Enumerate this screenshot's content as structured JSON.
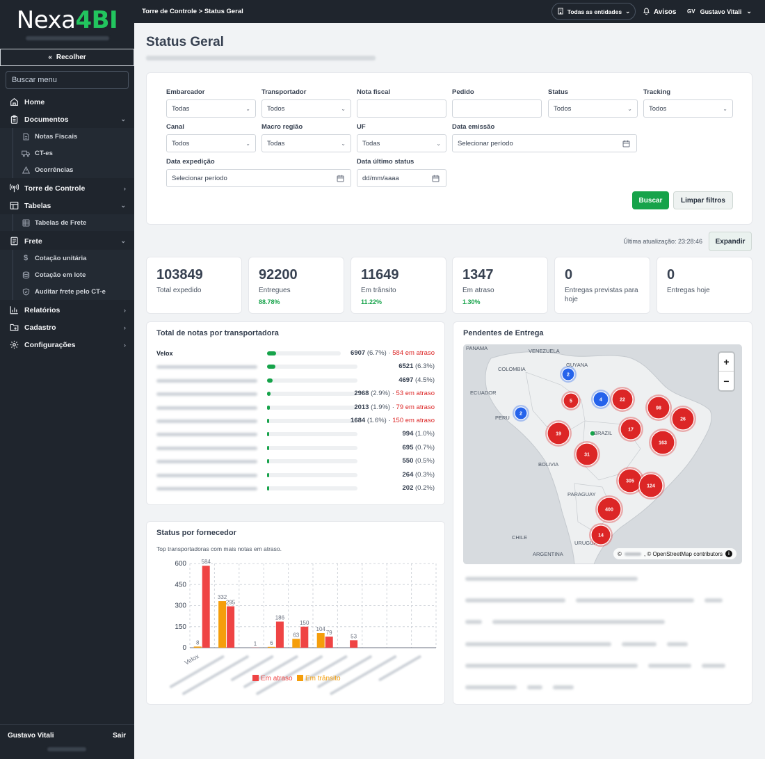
{
  "app": {
    "logo_main": "Nexa",
    "logo_accent": "4BI"
  },
  "sidebar": {
    "collapse_label": "Recolher",
    "search_placeholder": "Buscar menu",
    "items": [
      {
        "label": "Home",
        "icon": "home-icon"
      },
      {
        "label": "Documentos",
        "icon": "clipboard-icon",
        "expanded": true,
        "children": [
          {
            "label": "Notas Fiscais",
            "icon": "file-icon"
          },
          {
            "label": "CT-es",
            "icon": "truck-icon"
          },
          {
            "label": "Ocorrências",
            "icon": "warning-icon"
          }
        ]
      },
      {
        "label": "Torre de Controle",
        "icon": "antenna-icon",
        "expanded": false
      },
      {
        "label": "Tabelas",
        "icon": "table-icon",
        "expanded": true,
        "children": [
          {
            "label": "Tabelas de Frete",
            "icon": "grid-icon"
          }
        ]
      },
      {
        "label": "Frete",
        "icon": "receipt-icon",
        "expanded": true,
        "children": [
          {
            "label": "Cotação unitária",
            "icon": "dollar-icon"
          },
          {
            "label": "Cotação em lote",
            "icon": "layers-icon"
          },
          {
            "label": "Auditar frete pelo CT-e",
            "icon": "shield-check-icon"
          }
        ]
      },
      {
        "label": "Relatórios",
        "icon": "bar-chart-icon",
        "expanded": false
      },
      {
        "label": "Cadastro",
        "icon": "folder-icon",
        "expanded": false
      },
      {
        "label": "Configurações",
        "icon": "gear-icon",
        "expanded": false
      }
    ],
    "footer": {
      "user_name": "Gustavo Vitali",
      "logout_label": "Sair"
    }
  },
  "topbar": {
    "breadcrumb": "Torre de Controle > Status Geral",
    "entities_label": "Todas as entidades",
    "notifications_label": "Avisos",
    "user_initials": "GV",
    "user_name": "Gustavo Vitali"
  },
  "page": {
    "title": "Status Geral"
  },
  "filters": {
    "embarcador": {
      "label": "Embarcador",
      "value": "Todas"
    },
    "transportador": {
      "label": "Transportador",
      "value": "Todos"
    },
    "nota_fiscal": {
      "label": "Nota fiscal",
      "value": ""
    },
    "pedido": {
      "label": "Pedido",
      "value": ""
    },
    "status": {
      "label": "Status",
      "value": "Todos"
    },
    "tracking": {
      "label": "Tracking",
      "value": "Todos"
    },
    "canal": {
      "label": "Canal",
      "value": "Todos"
    },
    "macro_regiao": {
      "label": "Macro região",
      "value": "Todas"
    },
    "uf": {
      "label": "UF",
      "value": "Todas"
    },
    "data_emissao": {
      "label": "Data emissão",
      "placeholder": "Selecionar período"
    },
    "data_expedicao": {
      "label": "Data expedição",
      "placeholder": "Selecionar período"
    },
    "data_ultimo_status": {
      "label": "Data último status",
      "placeholder": "dd/mm/aaaa"
    },
    "search_button": "Buscar",
    "clear_button": "Limpar filtros"
  },
  "toolbar": {
    "last_update": "Última atualização: 23:28:46",
    "expand_button": "Expandir"
  },
  "kpis": [
    {
      "value": "103849",
      "label": "Total expedido",
      "pct": ""
    },
    {
      "value": "92200",
      "label": "Entregues",
      "pct": "88.78%"
    },
    {
      "value": "11649",
      "label": "Em trânsito",
      "pct": "11.22%"
    },
    {
      "value": "1347",
      "label": "Em atraso",
      "pct": "1.30%"
    },
    {
      "value": "0",
      "label": "Entregas previstas para hoje",
      "pct": ""
    },
    {
      "value": "0",
      "label": "Entregas hoje",
      "pct": ""
    }
  ],
  "carriers": {
    "title": "Total de notas por transportadora",
    "rows": [
      {
        "name": "Velox",
        "count": "6907",
        "pct": "(6.7%)",
        "late": "584 em atraso",
        "fraction": 0.067
      },
      {
        "name": "",
        "count": "6521",
        "pct": "(6.3%)",
        "late": "",
        "fraction": 0.063
      },
      {
        "name": "",
        "count": "4697",
        "pct": "(4.5%)",
        "late": "",
        "fraction": 0.045
      },
      {
        "name": "",
        "count": "2968",
        "pct": "(2.9%)",
        "late": "53 em atraso",
        "fraction": 0.029
      },
      {
        "name": "",
        "count": "2013",
        "pct": "(1.9%)",
        "late": "79 em atraso",
        "fraction": 0.019
      },
      {
        "name": "",
        "count": "1684",
        "pct": "(1.6%)",
        "late": "150 em atraso",
        "fraction": 0.016
      },
      {
        "name": "",
        "count": "994",
        "pct": "(1.0%)",
        "late": "",
        "fraction": 0.01
      },
      {
        "name": "",
        "count": "695",
        "pct": "(0.7%)",
        "late": "",
        "fraction": 0.007
      },
      {
        "name": "",
        "count": "550",
        "pct": "(0.5%)",
        "late": "",
        "fraction": 0.005
      },
      {
        "name": "",
        "count": "264",
        "pct": "(0.3%)",
        "late": "",
        "fraction": 0.003
      },
      {
        "name": "",
        "count": "202",
        "pct": "(0.2%)",
        "late": "",
        "fraction": 0.002
      }
    ]
  },
  "chart_data": {
    "type": "bar",
    "title": "Status por fornecedor",
    "subtitle": "Top transportadoras com mais notas em atraso.",
    "categories": [
      "Velox",
      "",
      "",
      "",
      "",
      "",
      "",
      "",
      "",
      ""
    ],
    "series": [
      {
        "name": "Em atraso",
        "color": "#ef4444",
        "values": [
          584,
          295,
          1,
          186,
          150,
          79,
          53,
          0,
          0,
          0
        ]
      },
      {
        "name": "Em trânsito",
        "color": "#f59e0b",
        "values": [
          8,
          332,
          0,
          6,
          63,
          104,
          0,
          0,
          0,
          0
        ]
      }
    ],
    "ylim": [
      0,
      600
    ],
    "yticks": [
      0,
      150,
      300,
      450,
      600
    ],
    "grid": true,
    "legend": "bottom"
  },
  "map": {
    "title": "Pendentes de Entrega",
    "attribution_text": ", © OpenStreetMap contributors",
    "zoom_in": "+",
    "zoom_out": "−",
    "country_labels": [
      "PANAMA",
      "VENEZUELA",
      "GUYANA",
      "COLOMBIA",
      "ECUADOR",
      "PERU",
      "BRAZIL",
      "BOLIVIA",
      "PARAGUAY",
      "CHILE",
      "ARGENTINA",
      "URUGUAY"
    ],
    "clusters": [
      {
        "count": "2",
        "color": "#2563eb"
      },
      {
        "count": "4",
        "color": "#2563eb"
      },
      {
        "count": "2",
        "color": "#2563eb"
      },
      {
        "count": "5",
        "color": "#dc2626"
      },
      {
        "count": "22",
        "color": "#dc2626"
      },
      {
        "count": "98",
        "color": "#dc2626"
      },
      {
        "count": "26",
        "color": "#dc2626"
      },
      {
        "count": "17",
        "color": "#dc2626"
      },
      {
        "count": "163",
        "color": "#dc2626"
      },
      {
        "count": "19",
        "color": "#dc2626"
      },
      {
        "count": "31",
        "color": "#dc2626"
      },
      {
        "count": "305",
        "color": "#dc2626"
      },
      {
        "count": "124",
        "color": "#dc2626"
      },
      {
        "count": "400",
        "color": "#dc2626"
      },
      {
        "count": "14",
        "color": "#dc2626"
      }
    ]
  }
}
